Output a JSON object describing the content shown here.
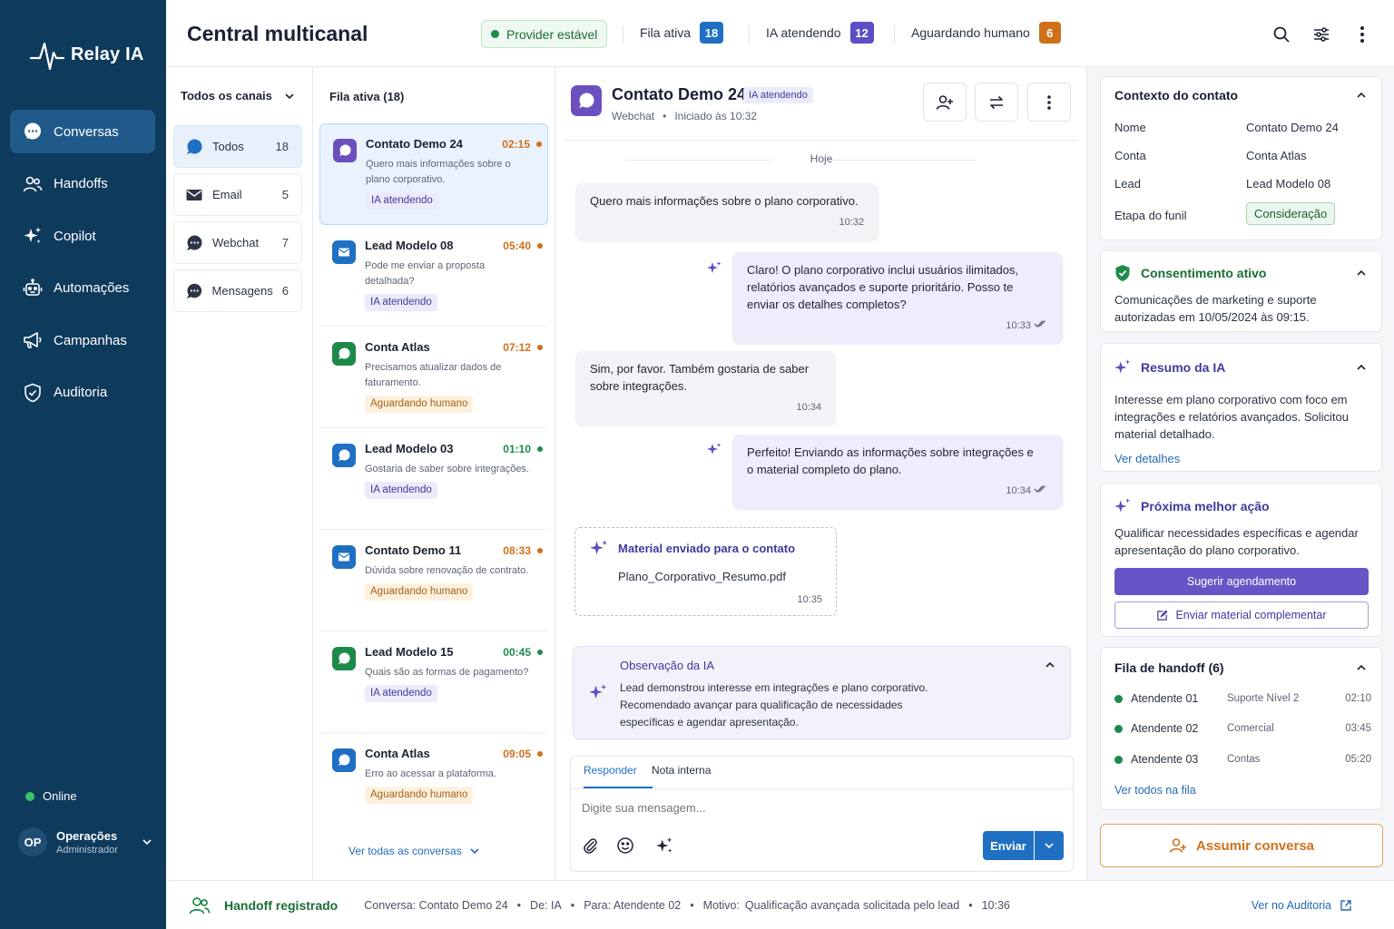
{
  "app": {
    "name": "Relay IA"
  },
  "sidebar": {
    "items": [
      {
        "label": "Conversas",
        "icon": "chat-icon",
        "active": true
      },
      {
        "label": "Handoffs",
        "icon": "users-icon"
      },
      {
        "label": "Copilot",
        "icon": "sparkle-icon"
      },
      {
        "label": "Automações",
        "icon": "robot-icon"
      },
      {
        "label": "Campanhas",
        "icon": "megaphone-icon"
      },
      {
        "label": "Auditoria",
        "icon": "shield-icon"
      }
    ],
    "status": "Online",
    "user": {
      "initials": "OP",
      "name": "Operações",
      "role": "Administrador"
    }
  },
  "header": {
    "title": "Central multicanal",
    "provider": "Provider estável",
    "stats": [
      {
        "label": "Fila ativa",
        "value": "18",
        "color": "#1f6fc2"
      },
      {
        "label": "IA atendendo",
        "value": "12",
        "color": "#5a4fc4"
      },
      {
        "label": "Aguardando humano",
        "value": "6",
        "color": "#d0701a"
      }
    ]
  },
  "channels": {
    "filter": "Todos os canais",
    "items": [
      {
        "label": "Todos",
        "count": "18",
        "icon": "chat-bubble-icon"
      },
      {
        "label": "Email",
        "count": "5",
        "icon": "envelope-icon"
      },
      {
        "label": "Webchat",
        "count": "7",
        "icon": "webchat-icon"
      },
      {
        "label": "Mensagens",
        "count": "6",
        "icon": "messages-icon"
      }
    ]
  },
  "list": {
    "title": "Fila ativa (18)",
    "see_all": "Ver todas as conversas",
    "items": [
      {
        "name": "Contato Demo 24",
        "time": "02:15",
        "preview": "Quero mais informações sobre o plano corporativo.",
        "tag": "IA atendendo",
        "status_color": "#d0701a",
        "icon_color": "#6b4fbf"
      },
      {
        "name": "Lead Modelo 08",
        "time": "05:40",
        "preview": "Pode me enviar a proposta detalhada?",
        "tag": "IA atendendo",
        "status_color": "#d0701a",
        "icon_color": "#1f6fc2"
      },
      {
        "name": "Conta Atlas",
        "time": "07:12",
        "preview": "Precisamos atualizar dados de faturamento.",
        "tag": "Aguardando humano",
        "status_color": "#d0701a",
        "icon_color": "#1e8a4a"
      },
      {
        "name": "Lead Modelo 03",
        "time": "01:10",
        "preview": "Gostaria de saber sobre integrações.",
        "tag": "IA atendendo",
        "status_color": "#1e8a4a",
        "icon_color": "#1f6fc2"
      },
      {
        "name": "Contato Demo 11",
        "time": "08:33",
        "preview": "Dúvida sobre renovação de contrato.",
        "tag": "Aguardando humano",
        "status_color": "#d0701a",
        "icon_color": "#1f6fc2"
      },
      {
        "name": "Lead Modelo 15",
        "time": "00:45",
        "preview": "Quais são as formas de pagamento?",
        "tag": "IA atendendo",
        "status_color": "#1e8a4a",
        "icon_color": "#1e8a4a"
      },
      {
        "name": "Conta Atlas",
        "time": "09:05",
        "preview": "Erro ao acessar a plataforma.",
        "tag": "Aguardando humano",
        "status_color": "#d0701a",
        "icon_color": "#1f6fc2"
      }
    ]
  },
  "chat": {
    "name": "Contato Demo 24",
    "badge": "IA atendendo",
    "channel": "Webchat",
    "bullet": "•",
    "started": "Iniciado às 10:32",
    "day": "Hoje",
    "messages": [
      {
        "text": "Quero mais informações sobre o plano corporativo.",
        "time": "10:32"
      },
      {
        "text": "Claro! O plano corporativo inclui usuários ilimitados, relatórios avançados e suporte prioritário. Posso te enviar os detalhes completos?",
        "time": "10:33"
      },
      {
        "text": "Sim, por favor. Também gostaria de saber sobre integrações.",
        "time": "10:34"
      },
      {
        "text": "Perfeito! Enviando as informações sobre integrações e o material completo do plano.",
        "time": "10:34"
      }
    ],
    "doc": {
      "title": "Material enviado para o contato",
      "file": "Plano_Corporativo_Resumo.pdf",
      "time": "10:35"
    },
    "observation": {
      "title": "Observação da IA",
      "text": "Lead demonstrou interesse em integrações e plano corporativo. Recomendado avançar para qualificação de necessidades específicas e agendar apresentação."
    },
    "compose": {
      "tab_reply": "Responder",
      "tab_note": "Nota interna",
      "placeholder": "Digite sua mensagem...",
      "send": "Enviar"
    }
  },
  "context": {
    "title": "Contexto do contato",
    "fields": [
      {
        "key": "Nome",
        "value": "Contato Demo 24"
      },
      {
        "key": "Conta",
        "value": "Conta Atlas"
      },
      {
        "key": "Lead",
        "value": "Lead Modelo 08"
      },
      {
        "key": "Etapa do funil",
        "value": "Consideração"
      }
    ]
  },
  "consent": {
    "title": "Consentimento ativo",
    "text": "Comunicações de marketing e suporte autorizadas em 10/05/2024 às 09:15."
  },
  "summary": {
    "title": "Resumo da IA",
    "text": "Interesse em plano corporativo com foco em integrações e relatórios avançados. Solicitou material detalhado.",
    "link": "Ver detalhes"
  },
  "next_action": {
    "title": "Próxima melhor ação",
    "text": "Qualificar necessidades específicas e agendar apresentação do plano corporativo.",
    "primary": "Sugerir agendamento",
    "secondary": "Enviar material complementar"
  },
  "handoff_queue": {
    "title": "Fila de handoff (6)",
    "agents": [
      {
        "name": "Atendente 01",
        "team": "Suporte Nível 2",
        "time": "02:10"
      },
      {
        "name": "Atendente 02",
        "team": "Comercial",
        "time": "03:45"
      },
      {
        "name": "Atendente 03",
        "team": "Contas",
        "time": "05:20"
      }
    ],
    "link": "Ver todos na fila"
  },
  "assume": "Assumir conversa",
  "footer": {
    "title": "Handoff registrado",
    "conversation": "Conversa: Contato Demo 24",
    "from": "De: IA",
    "to": "Para: Atendente 02",
    "reason_label": "Motivo:",
    "reason": "Qualificação avançada solicitada pelo lead",
    "time": "10:36",
    "bullet": "•",
    "link": "Ver no Auditoria"
  }
}
